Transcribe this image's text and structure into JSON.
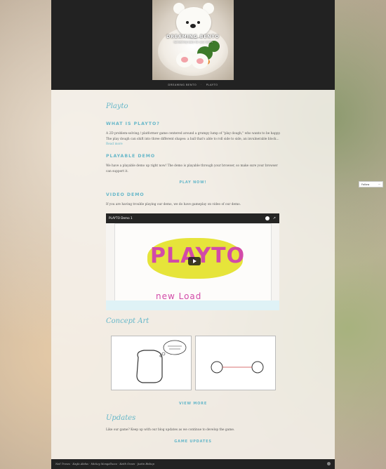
{
  "site": {
    "title": "DREAMING BENTO",
    "description": "Something tasty for your brain"
  },
  "nav": {
    "items": [
      "DREAMING BENTO",
      "PLAYTO"
    ]
  },
  "main": {
    "page_title": "Playto",
    "section1": {
      "heading": "WHAT IS PLAYTO?",
      "body": "A 2D problem-solving / platformer game centered around a grumpy lump of \"play dough,\" who wants to be happy. The play dough can shift into three different shapes: a ball that's able to roll side to side, an invulnerable block...",
      "read_more": "Read more"
    },
    "section2": {
      "heading": "PLAYABLE DEMO",
      "body": "We have a playable demo up right now! The demo is playable through your browser, so make sure your browser can support it.",
      "cta": "PLAY NOW!"
    },
    "section3": {
      "heading": "VIDEO DEMO",
      "body": "If you are having trouble playing our demo, we do have gameplay on video of our demo.",
      "video_title": "PLAYTO Demo 1",
      "video_logo": "PLAYTO",
      "video_subtitle": "new Load"
    },
    "concept_art": {
      "title": "Concept Art",
      "view_more": "VIEW MORE"
    },
    "updates": {
      "title": "Updates",
      "body": "Like our game? Keep up with our blog updates as we continue to develop the game.",
      "cta": "GAME UPDATES"
    }
  },
  "follow": {
    "label": "Follow"
  },
  "footer": {
    "credits": "Neil Treves · Kayla Abdus · Mickey Mongelluzzo · Keith Green · Justin Bishop"
  }
}
